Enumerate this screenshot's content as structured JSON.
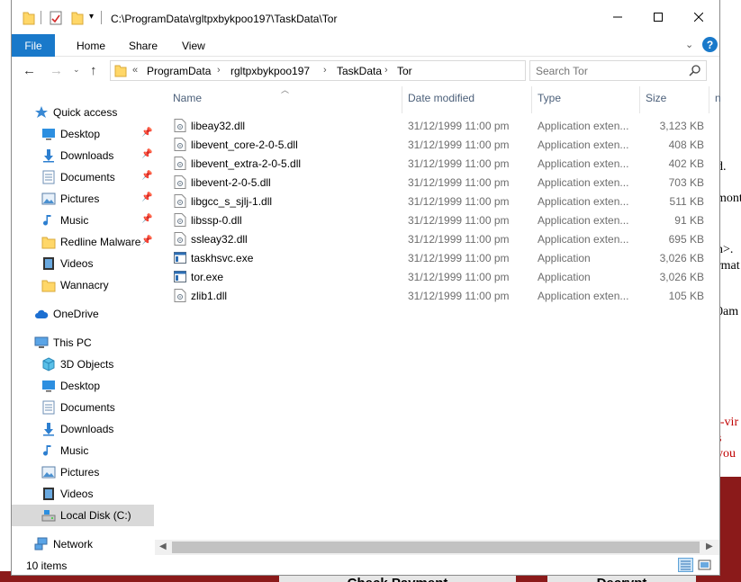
{
  "title_path": "C:\\ProgramData\\rgltpxbykpoo197\\TaskData\\Tor",
  "ribbon": {
    "file": "File",
    "tabs": [
      "Home",
      "Share",
      "View"
    ]
  },
  "address": {
    "overflow": "«",
    "segments": [
      "ProgramData",
      "rgltpxbykpoo197",
      "TaskData",
      "Tor"
    ]
  },
  "search": {
    "placeholder": "Search Tor"
  },
  "columns": {
    "name": "Name",
    "date": "Date modified",
    "type": "Type",
    "size": "Size",
    "extra": "n"
  },
  "sidebar": {
    "quick_access": "Quick access",
    "quick_items": [
      {
        "label": "Desktop",
        "icon": "desktop-icon"
      },
      {
        "label": "Downloads",
        "icon": "downloads-icon"
      },
      {
        "label": "Documents",
        "icon": "documents-icon"
      },
      {
        "label": "Pictures",
        "icon": "pictures-icon"
      },
      {
        "label": "Music",
        "icon": "music-icon"
      },
      {
        "label": "Redline Malware",
        "icon": "folder-icon"
      },
      {
        "label": "Videos",
        "icon": "videos-icon"
      },
      {
        "label": "Wannacry",
        "icon": "folder-icon"
      }
    ],
    "onedrive": "OneDrive",
    "this_pc": "This PC",
    "pc_items": [
      {
        "label": "3D Objects",
        "icon": "3d-objects-icon"
      },
      {
        "label": "Desktop",
        "icon": "desktop-icon"
      },
      {
        "label": "Documents",
        "icon": "documents-icon"
      },
      {
        "label": "Downloads",
        "icon": "downloads-icon"
      },
      {
        "label": "Music",
        "icon": "music-icon"
      },
      {
        "label": "Pictures",
        "icon": "pictures-icon"
      },
      {
        "label": "Videos",
        "icon": "videos-icon"
      },
      {
        "label": "Local Disk (C:)",
        "icon": "local-disk-icon"
      }
    ],
    "network": "Network"
  },
  "files": [
    {
      "name": "libeay32.dll",
      "date": "31/12/1999 11:00 pm",
      "type": "Application exten...",
      "size": "3,123 KB",
      "kind": "dll"
    },
    {
      "name": "libevent_core-2-0-5.dll",
      "date": "31/12/1999 11:00 pm",
      "type": "Application exten...",
      "size": "408 KB",
      "kind": "dll"
    },
    {
      "name": "libevent_extra-2-0-5.dll",
      "date": "31/12/1999 11:00 pm",
      "type": "Application exten...",
      "size": "402 KB",
      "kind": "dll"
    },
    {
      "name": "libevent-2-0-5.dll",
      "date": "31/12/1999 11:00 pm",
      "type": "Application exten...",
      "size": "703 KB",
      "kind": "dll"
    },
    {
      "name": "libgcc_s_sjlj-1.dll",
      "date": "31/12/1999 11:00 pm",
      "type": "Application exten...",
      "size": "511 KB",
      "kind": "dll"
    },
    {
      "name": "libssp-0.dll",
      "date": "31/12/1999 11:00 pm",
      "type": "Application exten...",
      "size": "91 KB",
      "kind": "dll"
    },
    {
      "name": "ssleay32.dll",
      "date": "31/12/1999 11:00 pm",
      "type": "Application exten...",
      "size": "695 KB",
      "kind": "dll"
    },
    {
      "name": "taskhsvc.exe",
      "date": "31/12/1999 11:00 pm",
      "type": "Application",
      "size": "3,026 KB",
      "kind": "exe"
    },
    {
      "name": "tor.exe",
      "date": "31/12/1999 11:00 pm",
      "type": "Application",
      "size": "3,026 KB",
      "kind": "exe"
    },
    {
      "name": "zlib1.dll",
      "date": "31/12/1999 11:00 pm",
      "type": "Application exten...",
      "size": "105 KB",
      "kind": "dll"
    }
  ],
  "status": {
    "count": "10 items"
  },
  "background_window": {
    "lines": [
      {
        "text": "d.",
        "color": "black"
      },
      {
        "text": "mont",
        "color": "black"
      },
      {
        "text": "n>.",
        "color": "black"
      },
      {
        "text": "rmat",
        "color": "black"
      },
      {
        "text": "0am",
        "color": "black"
      },
      {
        "text": "i-vir",
        "color": "red"
      },
      {
        "text": "s",
        "color": "red"
      },
      {
        "text": "you",
        "color": "red"
      }
    ],
    "buttons": [
      "Check Payment",
      "Decrypt"
    ]
  },
  "colors": {
    "accent": "#1979ca",
    "folder": "#ffd768",
    "bg_dark_red": "#8b1a1a",
    "bg_red_text": "#c00000"
  }
}
